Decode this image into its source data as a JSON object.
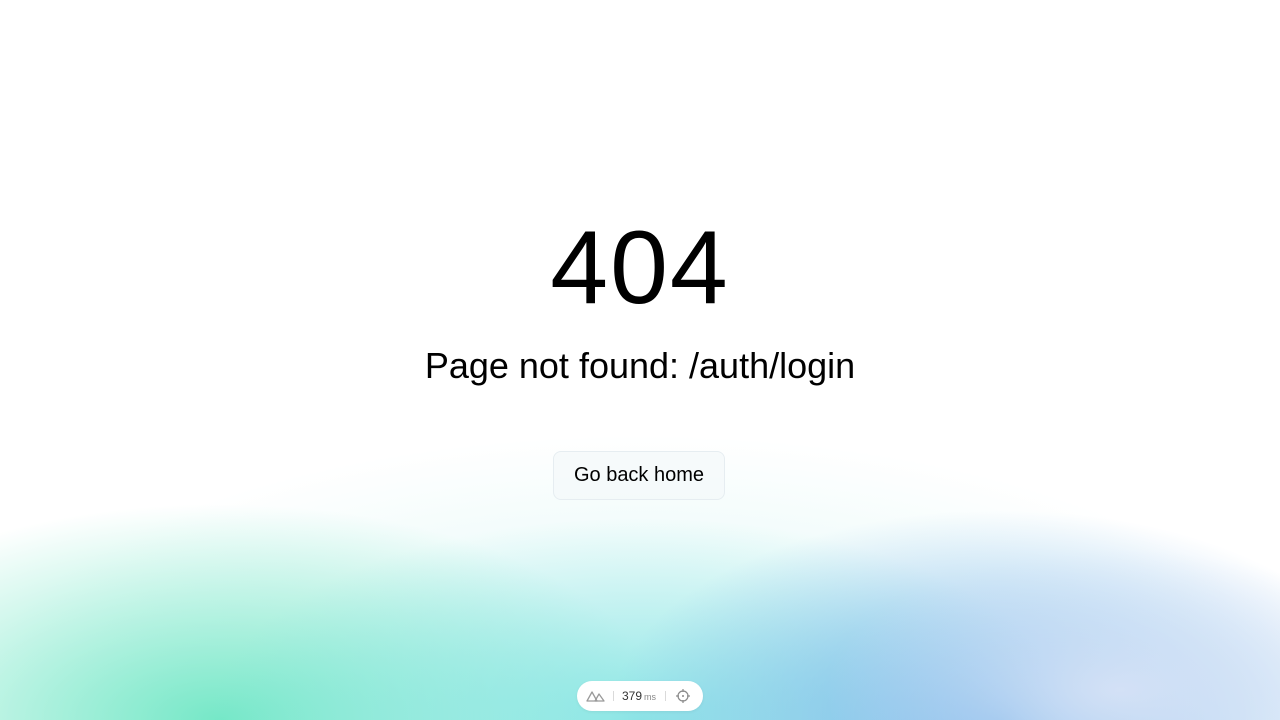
{
  "error": {
    "code": "404",
    "message": "Page not found: /auth/login"
  },
  "actions": {
    "home_label": "Go back home"
  },
  "devtools": {
    "timing_value": "379",
    "timing_unit": "ms",
    "logo_icon": "nuxt-logo-icon",
    "inspect_icon": "crosshair-icon"
  },
  "colors": {
    "background": "#ffffff",
    "gradient_green": "#60e4be",
    "gradient_teal": "#78e2e2",
    "gradient_blue": "#68aae8",
    "gradient_lavender": "#d6e2f6",
    "button_border": "#e6edf1",
    "text": "#000000"
  }
}
